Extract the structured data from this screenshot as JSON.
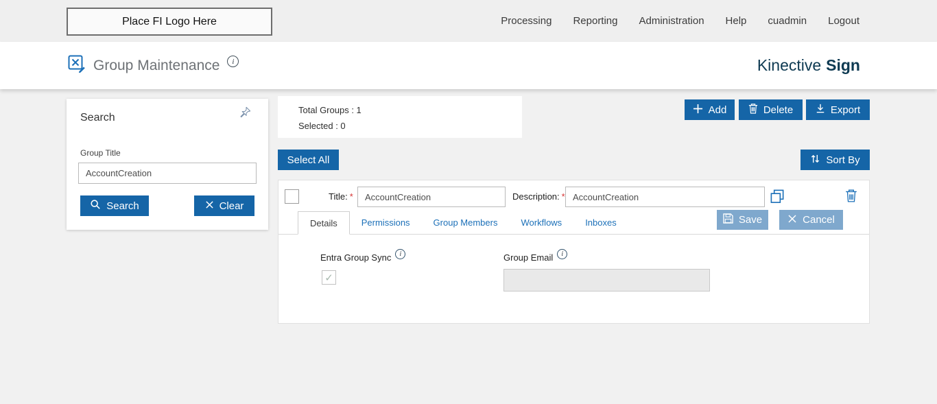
{
  "topbar": {
    "logo_placeholder": "Place FI Logo Here",
    "nav": [
      {
        "label": "Processing"
      },
      {
        "label": "Reporting"
      },
      {
        "label": "Administration"
      },
      {
        "label": "Help"
      },
      {
        "label": "cuadmin"
      },
      {
        "label": "Logout"
      }
    ]
  },
  "header": {
    "title": "Group Maintenance",
    "brand_name": "Kinective",
    "brand_suffix": "Sign"
  },
  "search_panel": {
    "title": "Search",
    "group_title_label": "Group Title",
    "group_title_value": "AccountCreation",
    "search_button": "Search",
    "clear_button": "Clear"
  },
  "summary": {
    "total_groups": "Total Groups : 1",
    "selected": "Selected : 0"
  },
  "toolbar": {
    "add_button": "Add",
    "delete_button": "Delete",
    "export_button": "Export",
    "select_all_button": "Select All",
    "sort_by_button": "Sort By"
  },
  "group_row": {
    "title_label": "Title:",
    "title_required": "*",
    "title_value": "AccountCreation",
    "description_label": "Description:",
    "description_required": "*",
    "description_value": "AccountCreation",
    "tabs": [
      {
        "label": "Details",
        "active": true
      },
      {
        "label": "Permissions",
        "active": false
      },
      {
        "label": "Group Members",
        "active": false
      },
      {
        "label": "Workflows",
        "active": false
      },
      {
        "label": "Inboxes",
        "active": false
      }
    ],
    "save_button": "Save",
    "cancel_button": "Cancel",
    "details_tab": {
      "entra_group_sync_label": "Entra Group Sync",
      "entra_group_sync_checked": true,
      "group_email_label": "Group Email",
      "group_email_value": ""
    }
  },
  "icons": {
    "info_glyph": "i",
    "check_glyph": "✓"
  },
  "colors": {
    "primary_button_blue": "#1565a7",
    "muted_button_blue": "#7fa8cd",
    "link_blue": "#1c70b8",
    "brand_navy": "#0e3a52",
    "required_red": "#d63333"
  }
}
